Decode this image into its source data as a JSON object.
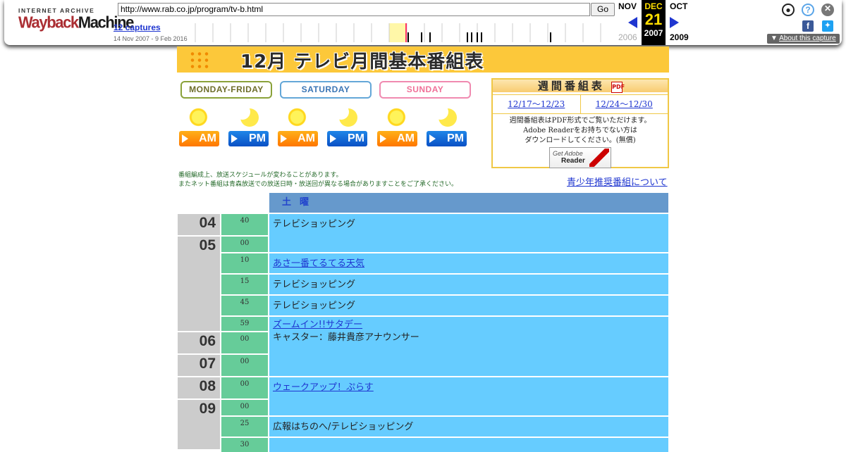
{
  "wayback": {
    "logo_top": "INTERNET ARCHIVE",
    "logo_way": "Wayback",
    "logo_machine": "Machine",
    "url": "http://www.rab.co.jp/program/tv-b.html",
    "go_label": "Go",
    "captures_label": "12 captures",
    "range_label": "14 Nov 2007 - 9 Feb 2016",
    "prev_month": "NOV",
    "current_month": "DEC",
    "next_month": "OCT",
    "current_day": "21",
    "prev_year": "2006",
    "current_year": "2007",
    "next_year": "2009",
    "about_label": "About this capture",
    "colors": {
      "link": "#1f36d0",
      "current_bg": "#000000",
      "current_day": "#ffde00"
    }
  },
  "page": {
    "banner_title": "12月 テレビ月間基本番組表",
    "day_tabs": [
      "MONDAY-FRIDAY",
      "SATURDAY",
      "SUNDAY"
    ],
    "ampm_buttons": [
      "AM",
      "PM",
      "AM",
      "PM",
      "AM",
      "PM"
    ],
    "weekly": {
      "title": "週間番組表",
      "pdf_icon": "PDF",
      "links": [
        "12/17～12/23",
        "12/24～12/30"
      ],
      "note_lines": [
        "週間番組表はPDF形式でご覧いただけます。",
        "Adobe Readerをお持ちでない方は",
        "ダウンロードしてください。(無償)"
      ],
      "adobe_get": "Get Adobe",
      "adobe_reader": "Reader"
    },
    "notes": [
      "番組編成上、放送スケジュールが変わることがあります。",
      "またネット番組は青森放送での放送日時・放送回が異なる場合がありますことをご了承ください。"
    ],
    "youth_link": "青少年推奨番組について",
    "schedule": {
      "day_header": "土曜",
      "hours": [
        "04",
        "05",
        "06",
        "07",
        "08",
        "09"
      ],
      "minutes": [
        "40",
        "00",
        "10",
        "15",
        "45",
        "59",
        "00",
        "00",
        "00",
        "00",
        "25",
        "30"
      ],
      "programs": [
        {
          "title": "テレビショッピング",
          "link": false,
          "sub": ""
        },
        {
          "title": "あさ一番てるてる天気",
          "link": true,
          "sub": ""
        },
        {
          "title": "テレビショッピング",
          "link": false,
          "sub": ""
        },
        {
          "title": "テレビショッピング",
          "link": false,
          "sub": ""
        },
        {
          "title": "ズームイン!!サタデー",
          "link": true,
          "sub": "キャスター：藤井貴彦アナウンサー"
        },
        {
          "title": "ウェークアップ！ぷらす",
          "link": true,
          "sub": ""
        },
        {
          "title": "広報はちのへ/テレビショッピング",
          "link": false,
          "sub": ""
        },
        {
          "title": "",
          "link": true,
          "sub": ""
        }
      ],
      "colors": {
        "hour": "#cccccc",
        "minute": "#66cc99",
        "program": "#66ccff",
        "header": "#6699cc"
      }
    }
  }
}
